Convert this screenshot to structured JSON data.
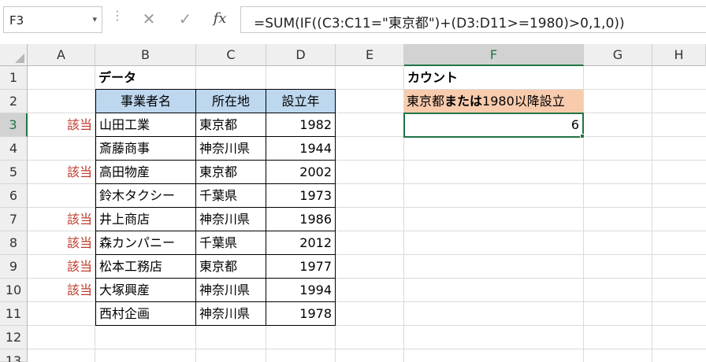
{
  "formula_bar": {
    "name_box": "F3",
    "name_box_dropdown_icon": "chevron-down-icon",
    "cancel_icon": "✕",
    "enter_icon": "✓",
    "fx_label": "fx",
    "formula": "=SUM(IF((C3:C11=\"東京都\")+(D3:D11>=1980)>0,1,0))"
  },
  "columns": [
    "A",
    "B",
    "C",
    "D",
    "E",
    "F",
    "G",
    "H"
  ],
  "selected_column": "F",
  "rows": [
    "1",
    "2",
    "3",
    "4",
    "5",
    "6",
    "7",
    "8",
    "9",
    "10",
    "11",
    "12",
    "13"
  ],
  "selected_row": "3",
  "sheet": {
    "B1": "データ",
    "table_headers": [
      "事業者名",
      "所在地",
      "設立年"
    ],
    "table_rows": [
      {
        "flag": "該当",
        "name": "山田工業",
        "loc": "東京都",
        "year": "1982"
      },
      {
        "flag": "",
        "name": "斎藤商事",
        "loc": "神奈川県",
        "year": "1944"
      },
      {
        "flag": "該当",
        "name": "高田物産",
        "loc": "東京都",
        "year": "2002"
      },
      {
        "flag": "",
        "name": "鈴木タクシー",
        "loc": "千葉県",
        "year": "1973"
      },
      {
        "flag": "該当",
        "name": "井上商店",
        "loc": "神奈川県",
        "year": "1986"
      },
      {
        "flag": "該当",
        "name": "森カンパニー",
        "loc": "千葉県",
        "year": "2012"
      },
      {
        "flag": "該当",
        "name": "松本工務店",
        "loc": "東京都",
        "year": "1977"
      },
      {
        "flag": "該当",
        "name": "大塚興産",
        "loc": "神奈川県",
        "year": "1994"
      },
      {
        "flag": "",
        "name": "西村企画",
        "loc": "神奈川県",
        "year": "1978"
      }
    ],
    "F1": "カウント",
    "F2_part1": "東京都",
    "F2_part2": "または",
    "F2_part3": "1980以降設立",
    "F3": "6"
  },
  "colors": {
    "accent_green": "#217346",
    "header_fill": "#bdd7ee",
    "criteria_fill": "#f8cbad",
    "flag_red": "#c0392b"
  }
}
